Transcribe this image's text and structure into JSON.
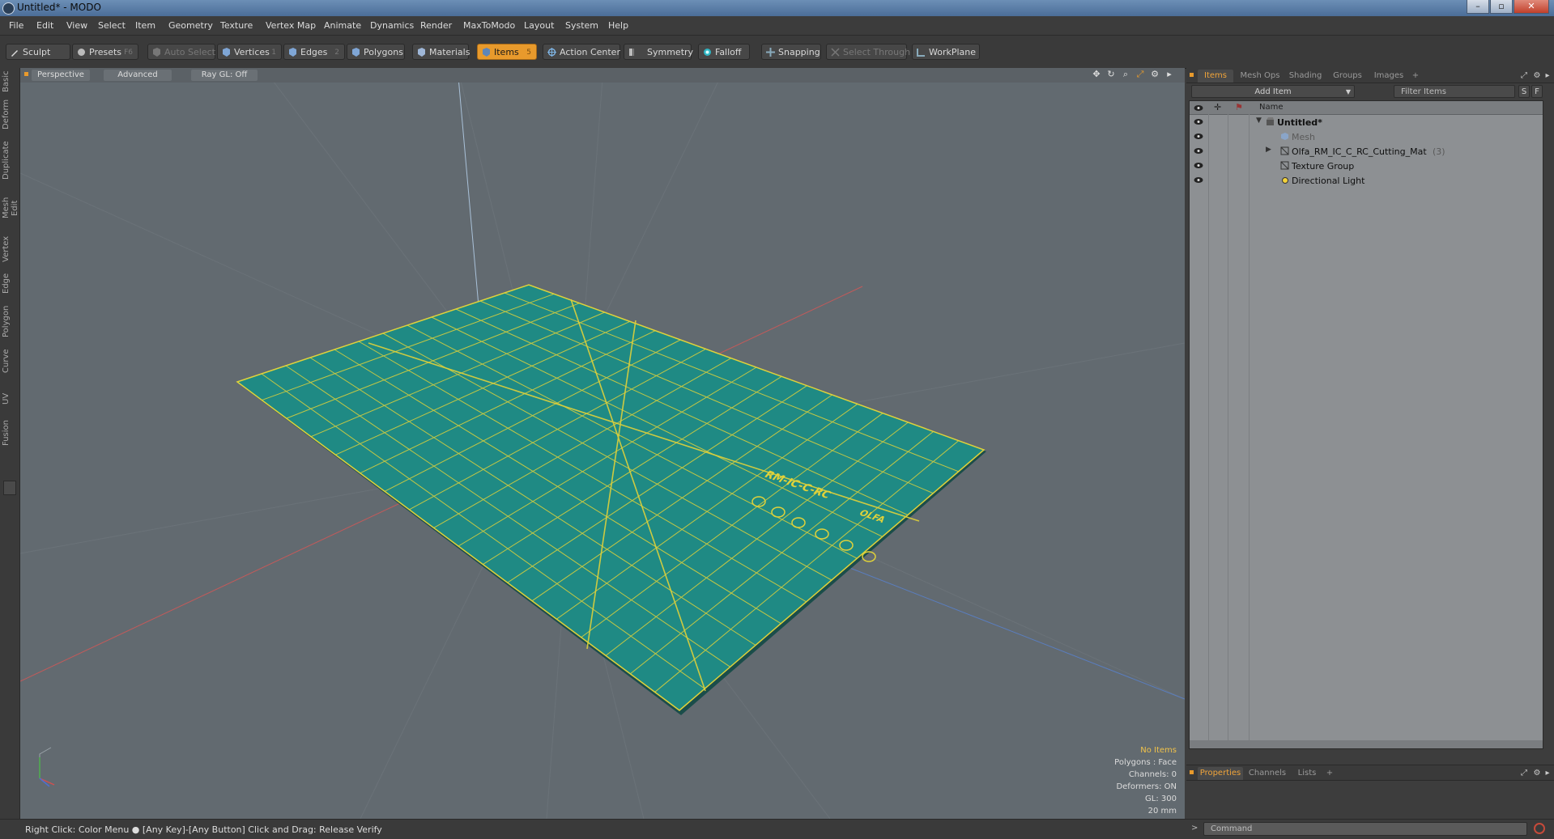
{
  "window": {
    "title": "Untitled* - MODO",
    "buttons": [
      "–",
      "▫",
      "✕"
    ]
  },
  "menu": [
    "File",
    "Edit",
    "View",
    "Select",
    "Item",
    "Geometry",
    "Texture",
    "Vertex Map",
    "Animate",
    "Dynamics",
    "Render",
    "MaxToModo",
    "Layout",
    "System",
    "Help"
  ],
  "toolbar": {
    "sculpt": "Sculpt",
    "presets": "Presets",
    "presets_key": "F6",
    "auto_select": "Auto Select",
    "vertices": "Vertices",
    "vertices_key": "1",
    "edges": "Edges",
    "edges_key": "2",
    "polygons": "Polygons",
    "materials": "Materials",
    "items": "Items",
    "items_key": "5",
    "action_center": "Action Center",
    "symmetry": "Symmetry",
    "falloff": "Falloff",
    "snapping": "Snapping",
    "select_through": "Select Through",
    "workplane": "WorkPlane"
  },
  "left_tabs": [
    "Basic",
    "Deform",
    "Duplicate",
    "Mesh Edit",
    "Vertex",
    "Edge",
    "Polygon",
    "Curve",
    "UV",
    "Fusion"
  ],
  "viewport": {
    "view_mode": "Perspective",
    "shading": "Advanced",
    "raygl": "Ray GL: Off",
    "info": {
      "selection": "No Items",
      "polygons": "Polygons : Face",
      "channels": "Channels: 0",
      "deformers": "Deformers: ON",
      "gl": "GL: 300",
      "grid": "20 mm"
    },
    "mat_text_model": "RM-IC-C-RC",
    "mat_text_brand": "OLFA",
    "mat_color": "#1f8a84",
    "grid_color": "#e0d23a"
  },
  "items_panel": {
    "tabs": [
      "Items",
      "Mesh Ops",
      "Shading",
      "Groups",
      "Images",
      "+"
    ],
    "add_item": "Add Item",
    "filter": "Filter Items",
    "filter_btns": [
      "S",
      "F"
    ],
    "col_name": "Name",
    "tree": [
      {
        "label": "Untitled*",
        "level": 0,
        "bold": true,
        "expand": "▼"
      },
      {
        "label": "Mesh",
        "level": 1,
        "dim": true,
        "expand": ""
      },
      {
        "label": "Olfa_RM_IC_C_RC_Cutting_Mat",
        "suffix": "(3)",
        "level": 1,
        "expand": "▶"
      },
      {
        "label": "Texture Group",
        "level": 1,
        "expand": ""
      },
      {
        "label": "Directional Light",
        "level": 1,
        "expand": ""
      }
    ]
  },
  "props_panel": {
    "tabs": [
      "Properties",
      "Channels",
      "Lists",
      "+"
    ]
  },
  "statusbar": {
    "hint": "Right Click: Color Menu  ●  [Any Key]-[Any Button] Click and Drag: Release Verify",
    "command_placeholder": "Command"
  }
}
